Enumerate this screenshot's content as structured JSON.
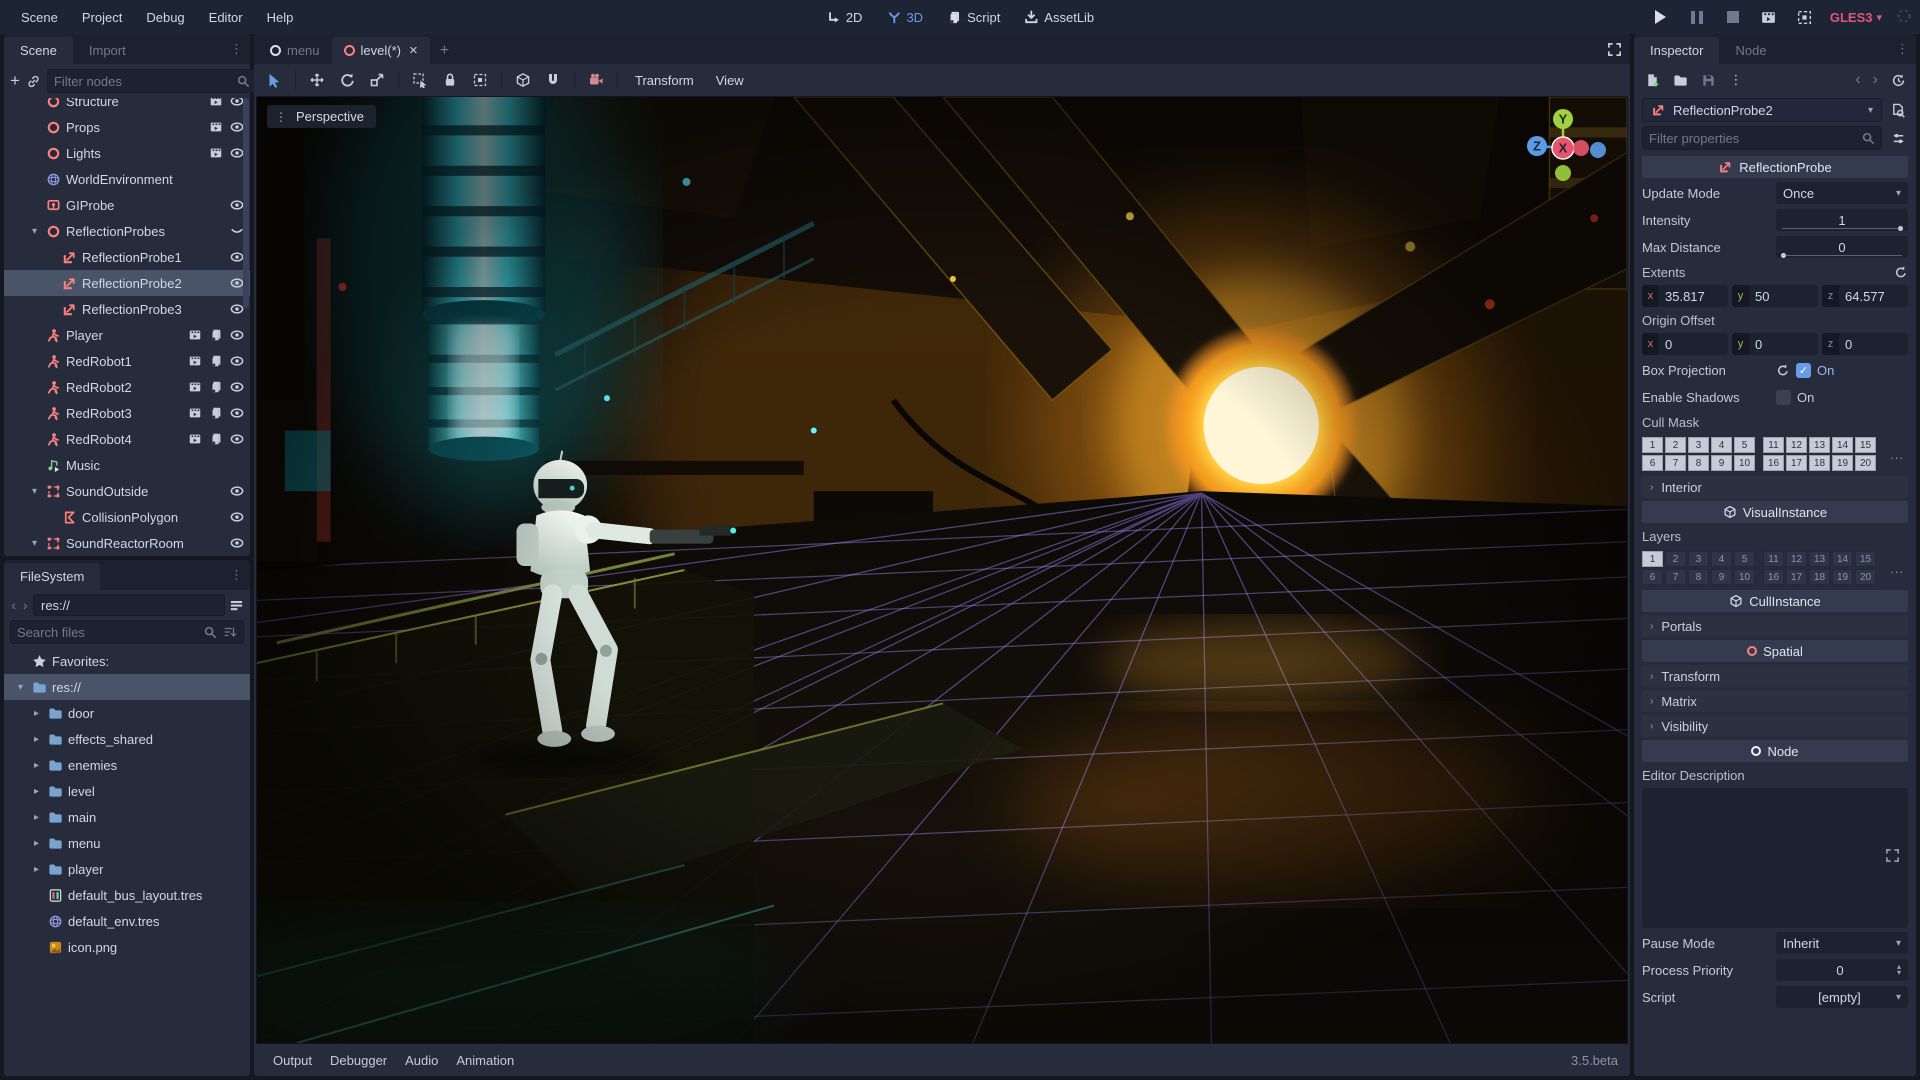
{
  "app": {
    "version": "3.5.beta",
    "renderer": "GLES3"
  },
  "icons": {
    "vdots": "⋮",
    "chevron_down": "▾",
    "back": "‹",
    "forward": "›",
    "close": "×",
    "plus": "+",
    "check": "✓",
    "more": "...",
    "colon": ":"
  },
  "colors": {
    "accent": "#699ce8",
    "salmon": "#fc7f7f",
    "renderer_badge": "#e0567a",
    "folder": "#7ba3d0",
    "grid": "#8f7ff0"
  },
  "menubar": {
    "items": [
      "Scene",
      "Project",
      "Debug",
      "Editor",
      "Help"
    ],
    "view_2d": "2D",
    "view_3d": "3D",
    "script": "Script",
    "assetlib": "AssetLib"
  },
  "left_dock": {
    "tabs": {
      "scene": "Scene",
      "import": "Import"
    },
    "scene_tree": {
      "filter_placeholder": "Filter nodes",
      "nodes": [
        {
          "name": "Structure",
          "icon": "spatial",
          "depth": 1,
          "trail": [
            "clapper",
            "eye"
          ]
        },
        {
          "name": "Props",
          "icon": "spatial",
          "depth": 1,
          "trail": [
            "clapper",
            "eye"
          ]
        },
        {
          "name": "Lights",
          "icon": "spatial",
          "depth": 1,
          "trail": [
            "clapper",
            "eye"
          ]
        },
        {
          "name": "WorldEnvironment",
          "icon": "worldenv",
          "depth": 1,
          "trail": []
        },
        {
          "name": "GIProbe",
          "icon": "giprobe",
          "depth": 1,
          "trail": [
            "eye"
          ]
        },
        {
          "name": "ReflectionProbes",
          "icon": "spatial",
          "depth": 1,
          "chev": "down",
          "trail": [
            "eyeclosed"
          ]
        },
        {
          "name": "ReflectionProbe1",
          "icon": "refprobe",
          "depth": 2,
          "trail": [
            "eye"
          ]
        },
        {
          "name": "ReflectionProbe2",
          "icon": "refprobe",
          "depth": 2,
          "sel": true,
          "trail": [
            "eye"
          ]
        },
        {
          "name": "ReflectionProbe3",
          "icon": "refprobe",
          "depth": 2,
          "trail": [
            "eye"
          ]
        },
        {
          "name": "Player",
          "icon": "player",
          "depth": 1,
          "trail": [
            "clapper",
            "script",
            "eye"
          ]
        },
        {
          "name": "RedRobot1",
          "icon": "player",
          "depth": 1,
          "trail": [
            "clapper",
            "script",
            "eye"
          ]
        },
        {
          "name": "RedRobot2",
          "icon": "player",
          "depth": 1,
          "trail": [
            "clapper",
            "script",
            "eye"
          ]
        },
        {
          "name": "RedRobot3",
          "icon": "player",
          "depth": 1,
          "trail": [
            "clapper",
            "script",
            "eye"
          ]
        },
        {
          "name": "RedRobot4",
          "icon": "player",
          "depth": 1,
          "trail": [
            "clapper",
            "script",
            "eye"
          ]
        },
        {
          "name": "Music",
          "icon": "music",
          "depth": 1,
          "trail": []
        },
        {
          "name": "SoundOutside",
          "icon": "area",
          "depth": 1,
          "chev": "down",
          "trail": [
            "eye"
          ]
        },
        {
          "name": "CollisionPolygon",
          "icon": "polygon",
          "depth": 2,
          "trail": [
            "eye"
          ]
        },
        {
          "name": "SoundReactorRoom",
          "icon": "area",
          "depth": 1,
          "chev": "down",
          "trail": [
            "eye"
          ]
        }
      ]
    },
    "filesystem": {
      "tab_label": "FileSystem",
      "path_value": "res://",
      "search_placeholder": "Search files",
      "entries": [
        {
          "label": "Favorites:",
          "icon": "star",
          "depth": 0
        },
        {
          "label": "res://",
          "icon": "folder",
          "depth": 0,
          "sel": true,
          "chev": "down"
        },
        {
          "label": "door",
          "icon": "folder",
          "depth": 1,
          "chev": "right"
        },
        {
          "label": "effects_shared",
          "icon": "folder",
          "depth": 1,
          "chev": "right"
        },
        {
          "label": "enemies",
          "icon": "folder",
          "depth": 1,
          "chev": "right"
        },
        {
          "label": "level",
          "icon": "folder",
          "depth": 1,
          "chev": "right"
        },
        {
          "label": "main",
          "icon": "folder",
          "depth": 1,
          "chev": "right"
        },
        {
          "label": "menu",
          "icon": "folder",
          "depth": 1,
          "chev": "right"
        },
        {
          "label": "player",
          "icon": "folder",
          "depth": 1,
          "chev": "right"
        },
        {
          "label": "default_bus_layout.tres",
          "icon": "buslayout",
          "depth": 1
        },
        {
          "label": "default_env.tres",
          "icon": "globefile",
          "depth": 1
        },
        {
          "label": "icon.png",
          "icon": "image",
          "depth": 1
        }
      ]
    }
  },
  "viewport": {
    "scene_tabs": [
      {
        "label": "menu",
        "ring": "white"
      },
      {
        "label": "level(*)",
        "ring": "red",
        "active": true,
        "closable": true
      }
    ],
    "toolbar_menus": {
      "transform": "Transform",
      "view": "View"
    },
    "perspective_label": "Perspective",
    "gizmo": {
      "x": "X",
      "y": "Y",
      "z": "Z"
    },
    "bottom_tabs": [
      "Output",
      "Debugger",
      "Audio",
      "Animation"
    ]
  },
  "inspector": {
    "tabs": {
      "inspector": "Inspector",
      "node": "Node"
    },
    "selected_node": "ReflectionProbe2",
    "filter_placeholder": "Filter properties",
    "categories": {
      "reflection_probe": "ReflectionProbe",
      "visual_instance": "VisualInstance",
      "cull_instance": "CullInstance",
      "spatial": "Spatial",
      "node": "Node"
    },
    "props": {
      "update_mode": {
        "label": "Update Mode",
        "value": "Once"
      },
      "intensity": {
        "label": "Intensity",
        "value": "1"
      },
      "max_distance": {
        "label": "Max Distance",
        "value": "0"
      },
      "extents": {
        "label": "Extents",
        "x": "35.817",
        "y": "50",
        "z": "64.577"
      },
      "origin_offset": {
        "label": "Origin Offset",
        "x": "0",
        "y": "0",
        "z": "0"
      },
      "box_projection": {
        "label": "Box Projection",
        "value": "On"
      },
      "enable_shadows": {
        "label": "Enable Shadows",
        "value": "On"
      },
      "cull_mask": {
        "label": "Cull Mask"
      },
      "interior": {
        "label": "Interior"
      },
      "layers": {
        "label": "Layers"
      },
      "portals": {
        "label": "Portals"
      },
      "transform": {
        "label": "Transform"
      },
      "matrix": {
        "label": "Matrix"
      },
      "visibility": {
        "label": "Visibility"
      },
      "editor_description": {
        "label": "Editor Description"
      },
      "pause_mode": {
        "label": "Pause Mode",
        "value": "Inherit"
      },
      "process_priority": {
        "label": "Process Priority",
        "value": "0"
      },
      "script": {
        "label": "Script",
        "value": "[empty]"
      }
    },
    "axis_labels": {
      "x": "x",
      "y": "y",
      "z": "z"
    },
    "cull_mask": {
      "r1": [
        {
          "n": 1,
          "on": true
        },
        {
          "n": 2,
          "on": true
        },
        {
          "n": 3,
          "on": true
        },
        {
          "n": 4,
          "on": true
        },
        {
          "n": 5,
          "on": true
        },
        {
          "n": 11,
          "on": true
        },
        {
          "n": 12,
          "on": true
        },
        {
          "n": 13,
          "on": true
        },
        {
          "n": 14,
          "on": true
        },
        {
          "n": 15,
          "on": true
        }
      ],
      "r2": [
        {
          "n": 6,
          "on": true
        },
        {
          "n": 7,
          "on": true
        },
        {
          "n": 8,
          "on": true
        },
        {
          "n": 9,
          "on": true
        },
        {
          "n": 10,
          "on": true
        },
        {
          "n": 16,
          "on": true
        },
        {
          "n": 17,
          "on": true
        },
        {
          "n": 18,
          "on": true
        },
        {
          "n": 19,
          "on": true
        },
        {
          "n": 20,
          "on": true
        }
      ]
    },
    "layers": {
      "r1": [
        {
          "n": 1,
          "on": true
        },
        {
          "n": 2
        },
        {
          "n": 3
        },
        {
          "n": 4
        },
        {
          "n": 5
        },
        {
          "n": 11
        },
        {
          "n": 12
        },
        {
          "n": 13
        },
        {
          "n": 14
        },
        {
          "n": 15
        }
      ],
      "r2": [
        {
          "n": 6
        },
        {
          "n": 7
        },
        {
          "n": 8
        },
        {
          "n": 9
        },
        {
          "n": 10
        },
        {
          "n": 16
        },
        {
          "n": 17
        },
        {
          "n": 18
        },
        {
          "n": 19
        },
        {
          "n": 20
        }
      ]
    }
  }
}
